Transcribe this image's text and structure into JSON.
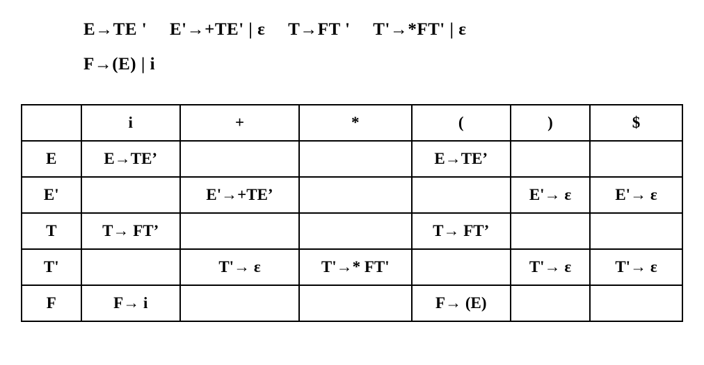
{
  "grammar": {
    "rules": [
      "E→TE '",
      "E'→+TE' | ε",
      "T→FT '",
      "T'→*FT' | ε",
      "F→(E) | i"
    ]
  },
  "chart_data": {
    "type": "table",
    "title": "LL(1) parsing table",
    "columns": [
      "i",
      "+",
      "*",
      "(",
      ")",
      "$"
    ],
    "rows": [
      "E",
      "E'",
      "T",
      "T'",
      "F"
    ],
    "cells": {
      "E": {
        "i": "E→TE’",
        "+": "",
        "*": "",
        "(": "E→TE’",
        ")": "",
        "$": ""
      },
      "E'": {
        "i": "",
        "+": "E'→+TE’",
        "*": "",
        "(": "",
        ")": "E'→ ε",
        "$": "E'→ ε"
      },
      "T": {
        "i": "T→ FT’",
        "+": "",
        "*": "",
        "(": "T→ FT’",
        ")": "",
        "$": ""
      },
      "T'": {
        "i": "",
        "+": "T'→ ε",
        "*": "T'→* FT'",
        "(": "",
        ")": "T'→ ε",
        "$": "T'→ ε"
      },
      "F": {
        "i": "F→ i",
        "+": "",
        "*": "",
        "(": "F→ (E)",
        ")": "",
        "$": ""
      }
    }
  }
}
